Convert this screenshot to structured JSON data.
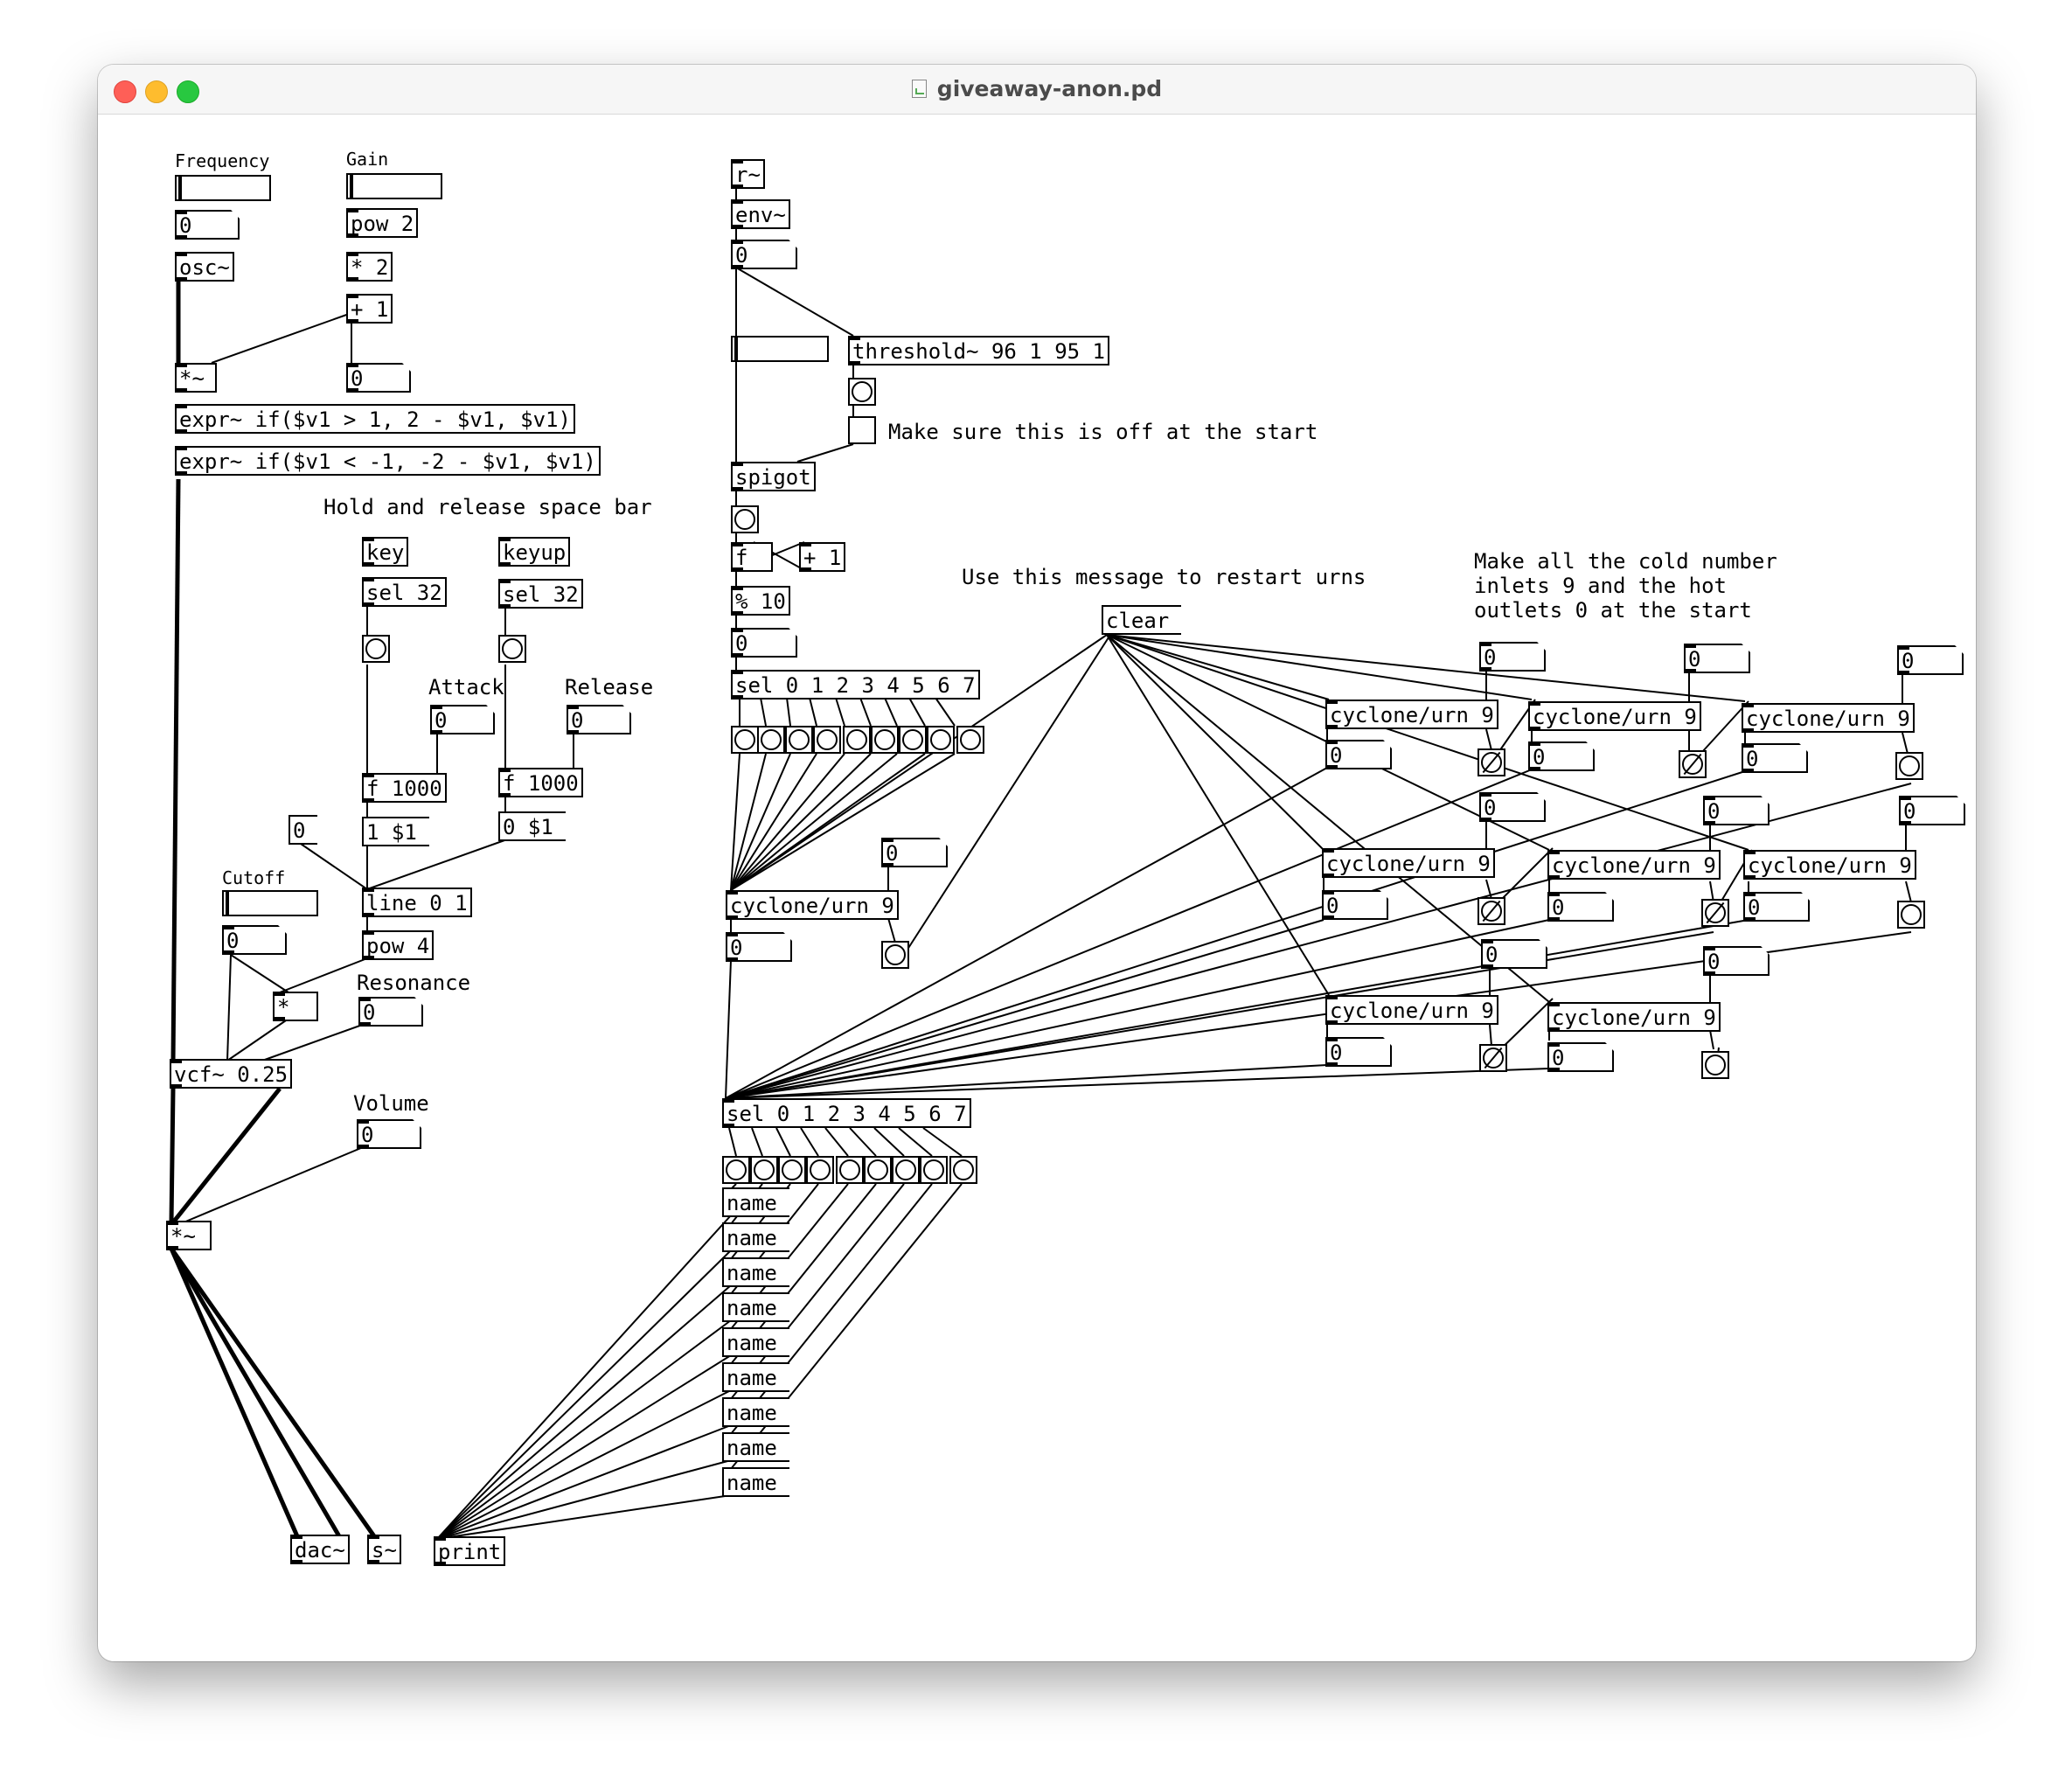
{
  "window": {
    "title": "giveaway-anon.pd",
    "file_icon": "pd-file-icon"
  },
  "comments": {
    "frequency": "Frequency",
    "gain": "Gain",
    "hold": "Hold and release space bar",
    "attack": "Attack",
    "release": "Release",
    "cutoff": "Cutoff",
    "resonance": "Resonance",
    "volume": "Volume",
    "toggle_note": "Make sure this is off at the start",
    "clear_note": "Use this message to restart urns",
    "cold_note_1": "Make all the cold number",
    "cold_note_2": "inlets 9 and the hot",
    "cold_note_3": "outlets 0 at the start"
  },
  "objects": {
    "osc": "osc~",
    "pow2": "pow 2",
    "mul2": "* 2",
    "add1": "+ 1",
    "mulsig1": "*~",
    "expr1": "expr~ if($v1 > 1, 2 - $v1, $v1)",
    "expr2": "expr~ if($v1 < -1, -2 - $v1, $v1)",
    "key": "key",
    "keyup": "keyup",
    "sel32a": "sel 32",
    "sel32b": "sel 32",
    "f1000a": "f 1000",
    "f1000b": "f 1000",
    "line": "line 0 1",
    "pow4": "pow 4",
    "mul": "*",
    "vcf": "vcf~ 0.25",
    "mulsig2": "*~",
    "dac": "dac~",
    "send": "s~",
    "print": "print",
    "receive": "r~",
    "env": "env~",
    "threshold": "threshold~ 96 1 95 1",
    "spigot": "spigot",
    "f": "f",
    "plus1": "+ 1",
    "mod10": "% 10",
    "sel07a": "sel 0 1 2 3 4 5 6 7",
    "urn_main": "cyclone/urn 9",
    "sel07b": "sel 0 1 2 3 4 5 6 7",
    "urn": "cyclone/urn 9"
  },
  "messages": {
    "msg_zero": "0",
    "msg_1": "1 $1",
    "msg_0": "0 $1",
    "clear": "clear",
    "name": "name"
  },
  "numbers": {
    "zero": "0"
  }
}
